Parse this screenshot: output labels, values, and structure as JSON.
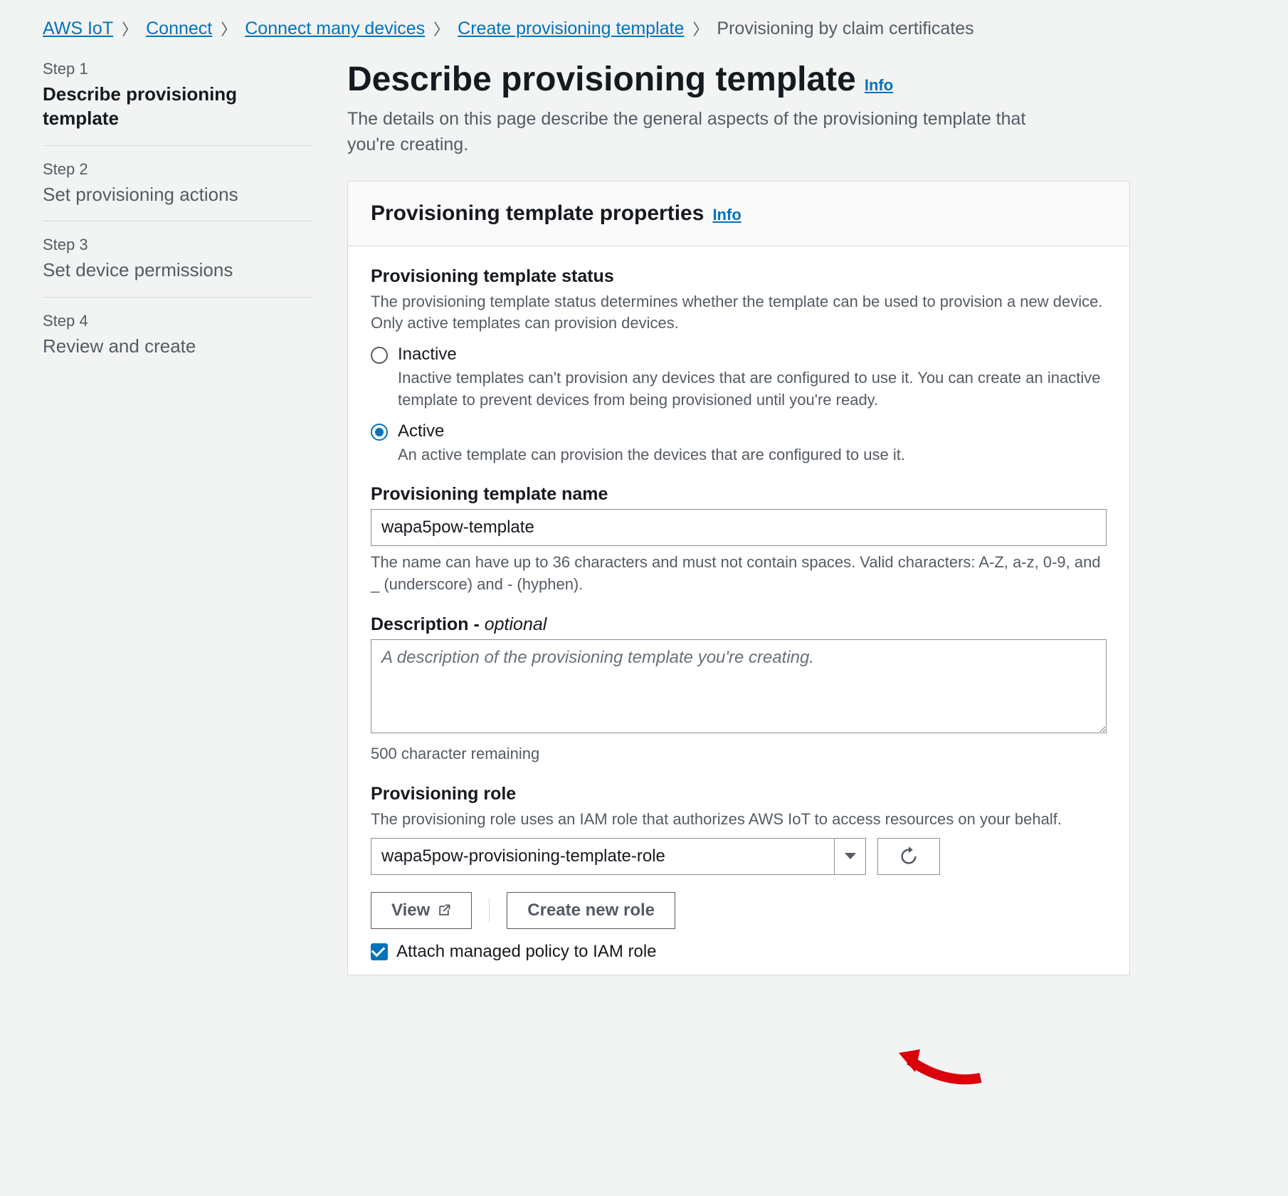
{
  "breadcrumb": {
    "items": [
      "AWS IoT",
      "Connect",
      "Connect many devices",
      "Create provisioning template"
    ],
    "current": "Provisioning by claim certificates"
  },
  "steps": [
    {
      "number": "Step 1",
      "title": "Describe provisioning template",
      "active": true
    },
    {
      "number": "Step 2",
      "title": "Set provisioning actions",
      "active": false
    },
    {
      "number": "Step 3",
      "title": "Set device permissions",
      "active": false
    },
    {
      "number": "Step 4",
      "title": "Review and create",
      "active": false
    }
  ],
  "header": {
    "title": "Describe provisioning template",
    "info": "Info",
    "desc": "The details on this page describe the general aspects of the provisioning template that you're creating."
  },
  "panel": {
    "title": "Provisioning template properties",
    "info": "Info"
  },
  "status": {
    "label": "Provisioning template status",
    "hint": "The provisioning template status determines whether the template can be used to provision a new device. Only active templates can provision devices.",
    "options": [
      {
        "title": "Inactive",
        "desc": "Inactive templates can't provision any devices that are configured to use it. You can create an inactive template to prevent devices from being provisioned until you're ready.",
        "checked": false
      },
      {
        "title": "Active",
        "desc": "An active template can provision the devices that are configured to use it.",
        "checked": true
      }
    ]
  },
  "name": {
    "label": "Provisioning template name",
    "value": "wapa5pow-template",
    "hint": "The name can have up to 36 characters and must not contain spaces. Valid characters: A-Z, a-z, 0-9, and _ (underscore) and - (hyphen)."
  },
  "description": {
    "label_prefix": "Description - ",
    "label_optional": "optional",
    "placeholder": "A description of the provisioning template you're creating.",
    "hint": "500 character remaining"
  },
  "role": {
    "label": "Provisioning role",
    "hint": "The provisioning role uses an IAM role that authorizes AWS IoT to access resources on your behalf.",
    "selected": "wapa5pow-provisioning-template-role",
    "view": "View",
    "create": "Create new role",
    "attach_label": "Attach managed policy to IAM role"
  }
}
